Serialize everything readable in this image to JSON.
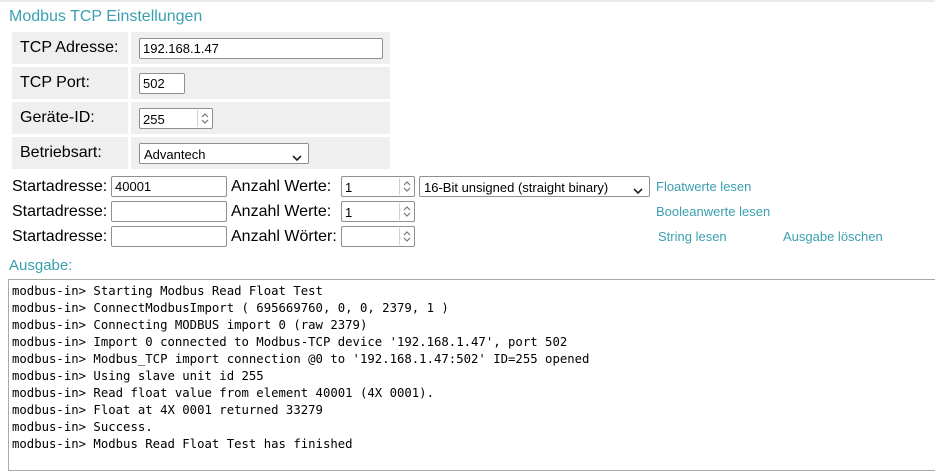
{
  "page_title": "Modbus TCP Einstellungen",
  "settings": {
    "tcp_address": {
      "label": "TCP Adresse:",
      "value": "192.168.1.47"
    },
    "tcp_port": {
      "label": "TCP Port:",
      "value": "502"
    },
    "device_id": {
      "label": "Geräte-ID:",
      "value": "255"
    },
    "mode": {
      "label": "Betriebsart:",
      "value": "Advantech"
    }
  },
  "float_row": {
    "start_label": "Startadresse:",
    "start_value": "40001",
    "count_label": "Anzahl Werte:",
    "count_value": "1",
    "format_value": "16-Bit unsigned (straight binary)",
    "action_link": "Floatwerte lesen"
  },
  "bool_row": {
    "start_label": "Startadresse:",
    "start_value": "",
    "count_label": "Anzahl Werte:",
    "count_value": "1",
    "action_link": "Booleanwerte lesen"
  },
  "string_row": {
    "start_label": "Startadresse:",
    "start_value": "",
    "count_label": "Anzahl Wörter:",
    "count_value": "",
    "action_link": "String lesen",
    "clear_link": "Ausgabe löschen"
  },
  "output": {
    "label": "Ausgabe:",
    "lines": [
      "modbus-in> Starting Modbus Read Float Test",
      "modbus-in> ConnectModbusImport ( 695669760, 0, 0, 2379, 1 )",
      "modbus-in> Connecting MODBUS import 0 (raw 2379)",
      "modbus-in> Import 0 connected to Modbus-TCP device '192.168.1.47', port 502",
      "modbus-in> Modbus_TCP import connection @0 to '192.168.1.47:502' ID=255 opened",
      "modbus-in> Using slave unit id 255",
      "modbus-in> Read float value from element 40001 (4X 0001).",
      "modbus-in> Float at 4X 0001 returned 33279",
      "modbus-in> Success.",
      "modbus-in> Modbus Read Float Test has finished"
    ]
  },
  "colors": {
    "accent": "#3a9fb0",
    "label_bg": "#efefef"
  }
}
